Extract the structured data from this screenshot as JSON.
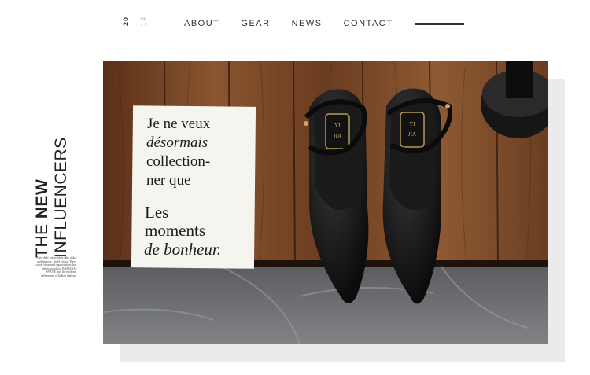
{
  "year": {
    "part1": "20",
    "part2": "14"
  },
  "nav": {
    "items": [
      {
        "label": "ABOUT"
      },
      {
        "label": "GEAR"
      },
      {
        "label": "NEWS"
      },
      {
        "label": "CONTACT"
      }
    ]
  },
  "title": {
    "line1_light": "THE ",
    "line1_bold": "NEW",
    "line2": "INFLUENCERS"
  },
  "blurb": "They defy convention, take risks and embody a bold vision. They create ideas and opportunities for others to follow. BAMANA SVANE lists the modern influencers of Indian fashion",
  "card": {
    "lines": [
      "Je ne veux",
      "désormais",
      "collection-",
      "ner que",
      "Les",
      "moments",
      "de bonheur."
    ]
  },
  "shoe_brand": {
    "line1": "YI",
    "line2": "JIA"
  },
  "colors": {
    "text": "#2b2b2b",
    "nav_bar": "#333333",
    "panel": "#ebebeb",
    "wood": "#7a4a2b",
    "stone": "#6f7175"
  }
}
